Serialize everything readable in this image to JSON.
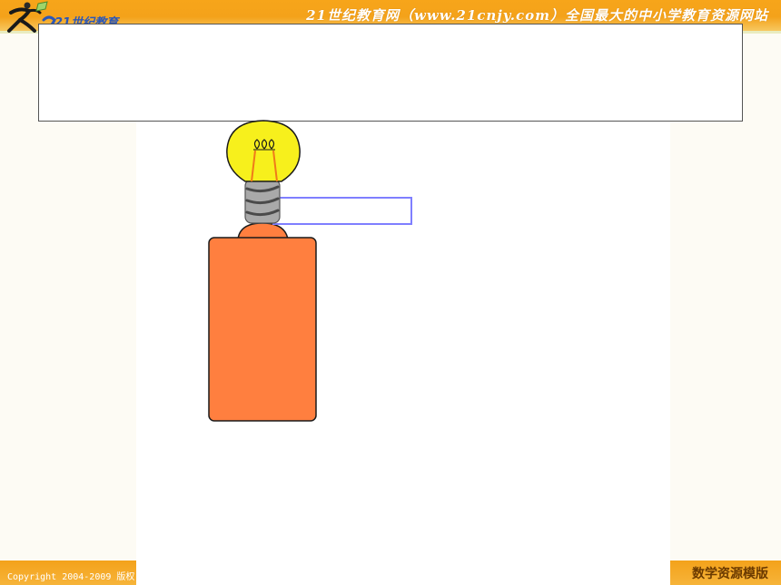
{
  "header": {
    "logo_text": "21世纪教育",
    "site_title": "21世纪教育网（www.21cnjy.com）全国最大的中小学教育资源网站"
  },
  "slide": {
    "text_box_content": ""
  },
  "footer": {
    "copyright": "Copyright 2004-2009 版权",
    "right_text": "数学资源模版"
  },
  "colors": {
    "header_orange": "#f4a21a",
    "battery_orange": "#ff7f3f",
    "bulb_yellow": "#f7f01c",
    "wire_blue": "#7f7fff"
  },
  "icons": {
    "logo": "running-figure-logo-icon",
    "bulb": "light-bulb-icon",
    "battery": "battery-icon"
  }
}
